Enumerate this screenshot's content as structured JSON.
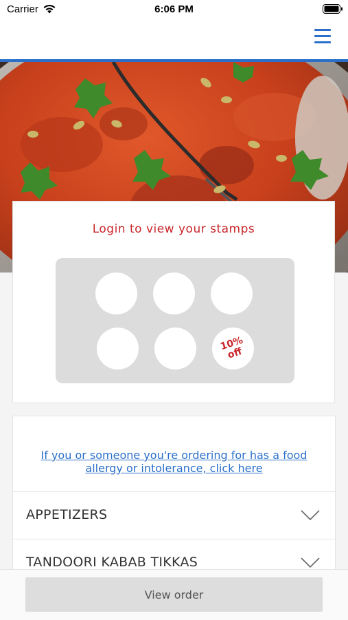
{
  "status_bar": {
    "carrier": "Carrier",
    "time": "6:06 PM",
    "icons": [
      "wifi-icon",
      "battery-icon"
    ]
  },
  "header": {
    "menu_icon": "hamburger-menu-icon",
    "accent_color": "#2a6fc9"
  },
  "hero": {
    "image": "curry-dish-photo"
  },
  "stamp_card": {
    "login_text": "Login to view your stamps",
    "stamps_total": 6,
    "reward_label_line1": "10%",
    "reward_label_line2": "off",
    "accent_color": "#c9262b"
  },
  "allergy_notice": {
    "line1": "If you or someone you're ordering for has a food",
    "line2": "allergy or intolerance, click here"
  },
  "categories": [
    {
      "label": "APPETIZERS"
    },
    {
      "label": "TANDOORI KABAB TIKKAS"
    }
  ],
  "footer": {
    "view_order_label": "View order"
  }
}
